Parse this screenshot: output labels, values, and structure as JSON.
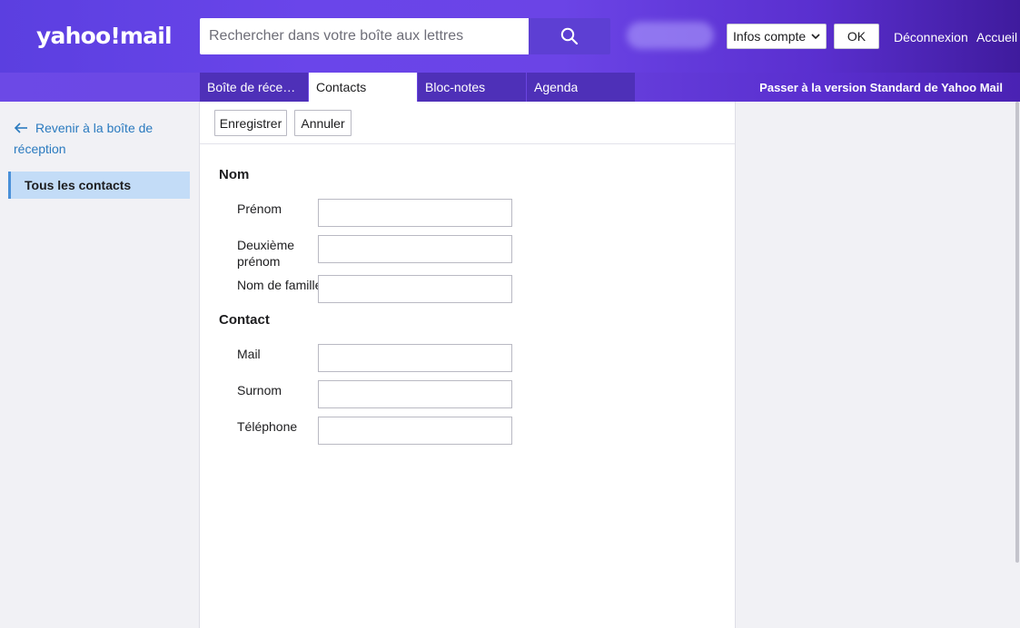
{
  "header": {
    "logo": "yahoo!mail",
    "search_placeholder": "Rechercher dans votre boîte aux lettres",
    "account_select": "Infos compte",
    "ok_label": "OK",
    "logout_label": "Déconnexion",
    "home_label": "Accueil"
  },
  "tabs": [
    {
      "label": "Boîte de récepti..."
    },
    {
      "label": "Contacts"
    },
    {
      "label": "Bloc-notes"
    },
    {
      "label": "Agenda"
    }
  ],
  "switch_link": "Passer à la version Standard de Yahoo Mail",
  "sidebar": {
    "back_label": "Revenir à la boîte de réception",
    "all_contacts": "Tous les contacts"
  },
  "toolbar": {
    "save_label": "Enregistrer",
    "cancel_label": "Annuler"
  },
  "form": {
    "name_section": "Nom",
    "first_name": "Prénom",
    "middle_name": "Deuxième prénom",
    "last_name": "Nom de famille",
    "contact_section": "Contact",
    "mail": "Mail",
    "nickname": "Surnom",
    "phone": "Téléphone"
  },
  "colors": {
    "header_purple": "#6a45ea",
    "link_blue": "#2a7abf",
    "active_sidebar": "#c3dcf7"
  }
}
